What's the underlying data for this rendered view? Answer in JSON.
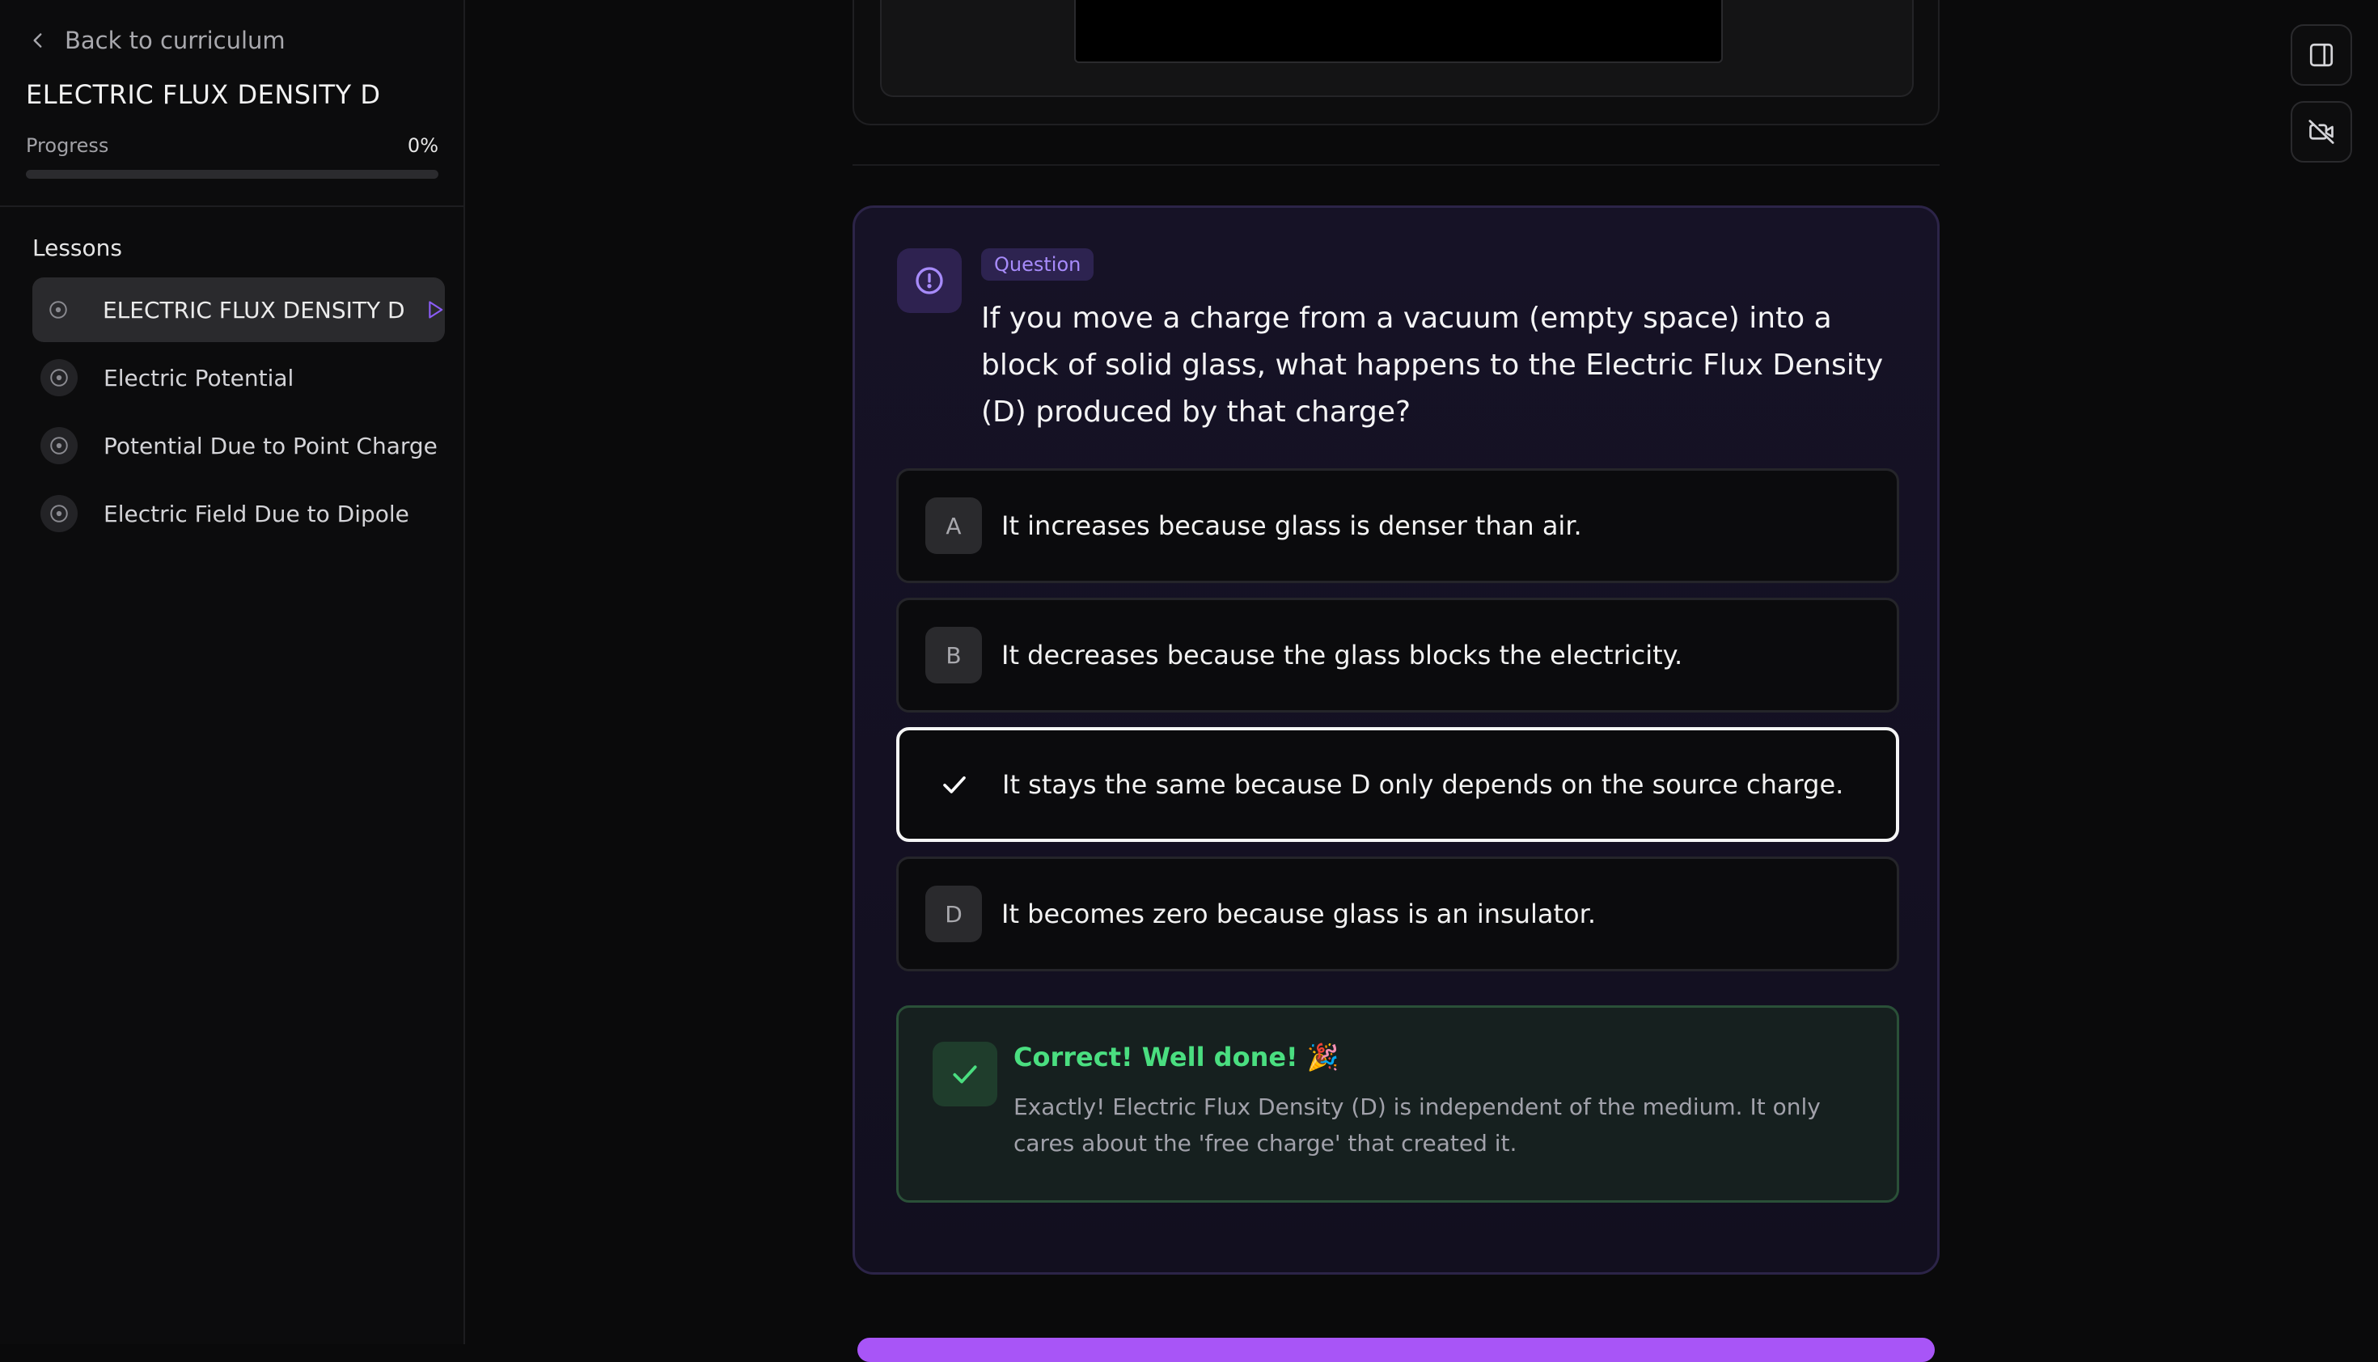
{
  "sidebar": {
    "back_label": "Back to curriculum",
    "course_title": "ELECTRIC FLUX DENSITY D",
    "progress_label": "Progress",
    "progress_value": "0%",
    "progress_fraction": 0,
    "lessons_heading": "Lessons",
    "lessons": [
      {
        "label": "ELECTRIC FLUX DENSITY D",
        "active": true
      },
      {
        "label": "Electric Potential",
        "active": false
      },
      {
        "label": "Potential Due to Point Charge",
        "active": false
      },
      {
        "label": "Electric Field Due to Dipole",
        "active": false
      }
    ]
  },
  "question": {
    "badge": "Question",
    "text": "If you move a charge from a vacuum (empty space) into a block of solid glass, what happens to the Electric Flux Density (D) produced by that charge?",
    "options": [
      {
        "letter": "A",
        "text": "It increases because glass is denser than air.",
        "selected": false
      },
      {
        "letter": "B",
        "text": "It decreases because the glass blocks the electricity.",
        "selected": false
      },
      {
        "letter": "C",
        "text": "It stays the same because D only depends on the source charge.",
        "selected": true
      },
      {
        "letter": "D",
        "text": "It becomes zero because glass is an insulator.",
        "selected": false
      }
    ]
  },
  "feedback": {
    "title": "Correct! Well done! 🎉",
    "body": "Exactly! Electric Flux Density (D) is independent of the medium. It only cares about the 'free charge' that created it."
  },
  "colors": {
    "accent": "#a78bfa",
    "success": "#4ade80",
    "background": "#0a0a0b"
  },
  "icons": {
    "back": "chevron-left-icon",
    "lesson": "target-circle-icon",
    "play": "play-triangle-icon",
    "question": "alert-circle-icon",
    "check": "check-icon",
    "panel": "sidebar-panel-icon",
    "camera_off": "video-off-icon"
  }
}
